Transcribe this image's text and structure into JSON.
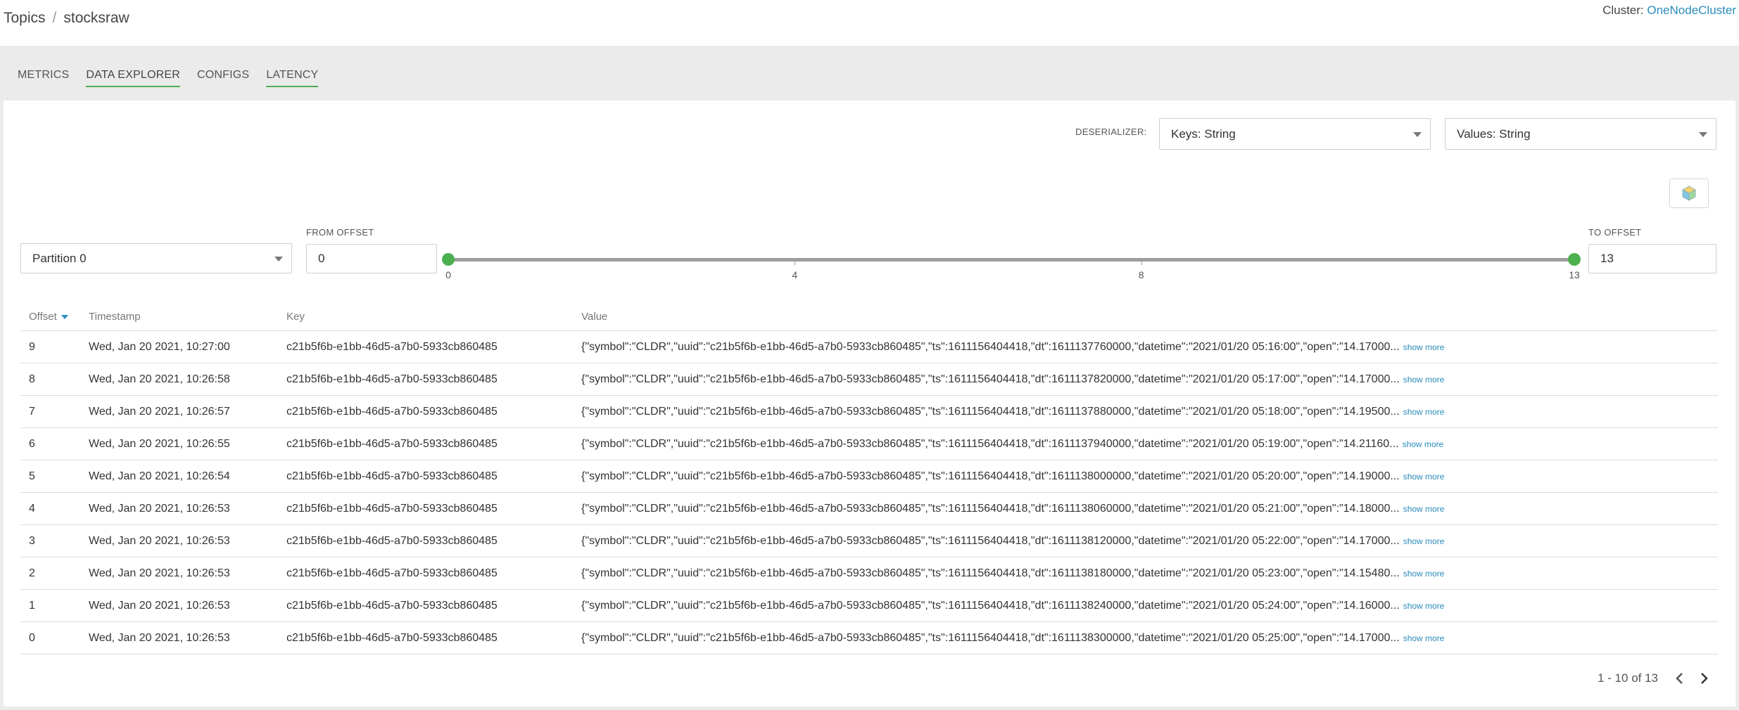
{
  "breadcrumb": {
    "root": "Topics",
    "separator": "/",
    "current": "stocksraw"
  },
  "cluster": {
    "label": "Cluster:",
    "name": "OneNodeCluster"
  },
  "tabs": [
    {
      "label": "METRICS"
    },
    {
      "label": "DATA EXPLORER"
    },
    {
      "label": "CONFIGS"
    },
    {
      "label": "LATENCY"
    }
  ],
  "deserializer": {
    "label": "DESERIALIZER:",
    "keys": "Keys: String",
    "values": "Values: String"
  },
  "partition": {
    "selected": "Partition 0"
  },
  "from_offset": {
    "label": "FROM OFFSET",
    "value": "0"
  },
  "to_offset": {
    "label": "TO OFFSET",
    "value": "13"
  },
  "slider": {
    "min": 0,
    "max": 13,
    "ticks": [
      "0",
      "4",
      "8",
      "13"
    ]
  },
  "table": {
    "headers": {
      "offset": "Offset",
      "timestamp": "Timestamp",
      "key": "Key",
      "value": "Value"
    },
    "show_more": "show more",
    "rows": [
      {
        "offset": "9",
        "timestamp": "Wed, Jan 20 2021, 10:27:00",
        "key": "c21b5f6b-e1bb-46d5-a7b0-5933cb860485",
        "value": "{\"symbol\":\"CLDR\",\"uuid\":\"c21b5f6b-e1bb-46d5-a7b0-5933cb860485\",\"ts\":1611156404418,\"dt\":1611137760000,\"datetime\":\"2021/01/20 05:16:00\",\"open\":\"14.17000..."
      },
      {
        "offset": "8",
        "timestamp": "Wed, Jan 20 2021, 10:26:58",
        "key": "c21b5f6b-e1bb-46d5-a7b0-5933cb860485",
        "value": "{\"symbol\":\"CLDR\",\"uuid\":\"c21b5f6b-e1bb-46d5-a7b0-5933cb860485\",\"ts\":1611156404418,\"dt\":1611137820000,\"datetime\":\"2021/01/20 05:17:00\",\"open\":\"14.17000..."
      },
      {
        "offset": "7",
        "timestamp": "Wed, Jan 20 2021, 10:26:57",
        "key": "c21b5f6b-e1bb-46d5-a7b0-5933cb860485",
        "value": "{\"symbol\":\"CLDR\",\"uuid\":\"c21b5f6b-e1bb-46d5-a7b0-5933cb860485\",\"ts\":1611156404418,\"dt\":1611137880000,\"datetime\":\"2021/01/20 05:18:00\",\"open\":\"14.19500..."
      },
      {
        "offset": "6",
        "timestamp": "Wed, Jan 20 2021, 10:26:55",
        "key": "c21b5f6b-e1bb-46d5-a7b0-5933cb860485",
        "value": "{\"symbol\":\"CLDR\",\"uuid\":\"c21b5f6b-e1bb-46d5-a7b0-5933cb860485\",\"ts\":1611156404418,\"dt\":1611137940000,\"datetime\":\"2021/01/20 05:19:00\",\"open\":\"14.21160..."
      },
      {
        "offset": "5",
        "timestamp": "Wed, Jan 20 2021, 10:26:54",
        "key": "c21b5f6b-e1bb-46d5-a7b0-5933cb860485",
        "value": "{\"symbol\":\"CLDR\",\"uuid\":\"c21b5f6b-e1bb-46d5-a7b0-5933cb860485\",\"ts\":1611156404418,\"dt\":1611138000000,\"datetime\":\"2021/01/20 05:20:00\",\"open\":\"14.19000..."
      },
      {
        "offset": "4",
        "timestamp": "Wed, Jan 20 2021, 10:26:53",
        "key": "c21b5f6b-e1bb-46d5-a7b0-5933cb860485",
        "value": "{\"symbol\":\"CLDR\",\"uuid\":\"c21b5f6b-e1bb-46d5-a7b0-5933cb860485\",\"ts\":1611156404418,\"dt\":1611138060000,\"datetime\":\"2021/01/20 05:21:00\",\"open\":\"14.18000..."
      },
      {
        "offset": "3",
        "timestamp": "Wed, Jan 20 2021, 10:26:53",
        "key": "c21b5f6b-e1bb-46d5-a7b0-5933cb860485",
        "value": "{\"symbol\":\"CLDR\",\"uuid\":\"c21b5f6b-e1bb-46d5-a7b0-5933cb860485\",\"ts\":1611156404418,\"dt\":1611138120000,\"datetime\":\"2021/01/20 05:22:00\",\"open\":\"14.17000..."
      },
      {
        "offset": "2",
        "timestamp": "Wed, Jan 20 2021, 10:26:53",
        "key": "c21b5f6b-e1bb-46d5-a7b0-5933cb860485",
        "value": "{\"symbol\":\"CLDR\",\"uuid\":\"c21b5f6b-e1bb-46d5-a7b0-5933cb860485\",\"ts\":1611156404418,\"dt\":1611138180000,\"datetime\":\"2021/01/20 05:23:00\",\"open\":\"14.15480..."
      },
      {
        "offset": "1",
        "timestamp": "Wed, Jan 20 2021, 10:26:53",
        "key": "c21b5f6b-e1bb-46d5-a7b0-5933cb860485",
        "value": "{\"symbol\":\"CLDR\",\"uuid\":\"c21b5f6b-e1bb-46d5-a7b0-5933cb860485\",\"ts\":1611156404418,\"dt\":1611138240000,\"datetime\":\"2021/01/20 05:24:00\",\"open\":\"14.16000..."
      },
      {
        "offset": "0",
        "timestamp": "Wed, Jan 20 2021, 10:26:53",
        "key": "c21b5f6b-e1bb-46d5-a7b0-5933cb860485",
        "value": "{\"symbol\":\"CLDR\",\"uuid\":\"c21b5f6b-e1bb-46d5-a7b0-5933cb860485\",\"ts\":1611156404418,\"dt\":1611138300000,\"datetime\":\"2021/01/20 05:25:00\",\"open\":\"14.17000..."
      }
    ]
  },
  "pagination": {
    "text": "1 - 10 of 13"
  },
  "colors": {
    "accent": "#4caf50",
    "link": "#2a8bbd"
  },
  "icons": {
    "export": "cube-icon",
    "prev": "chevron-left-icon",
    "next": "chevron-right-icon",
    "sort": "sort-desc-icon"
  }
}
